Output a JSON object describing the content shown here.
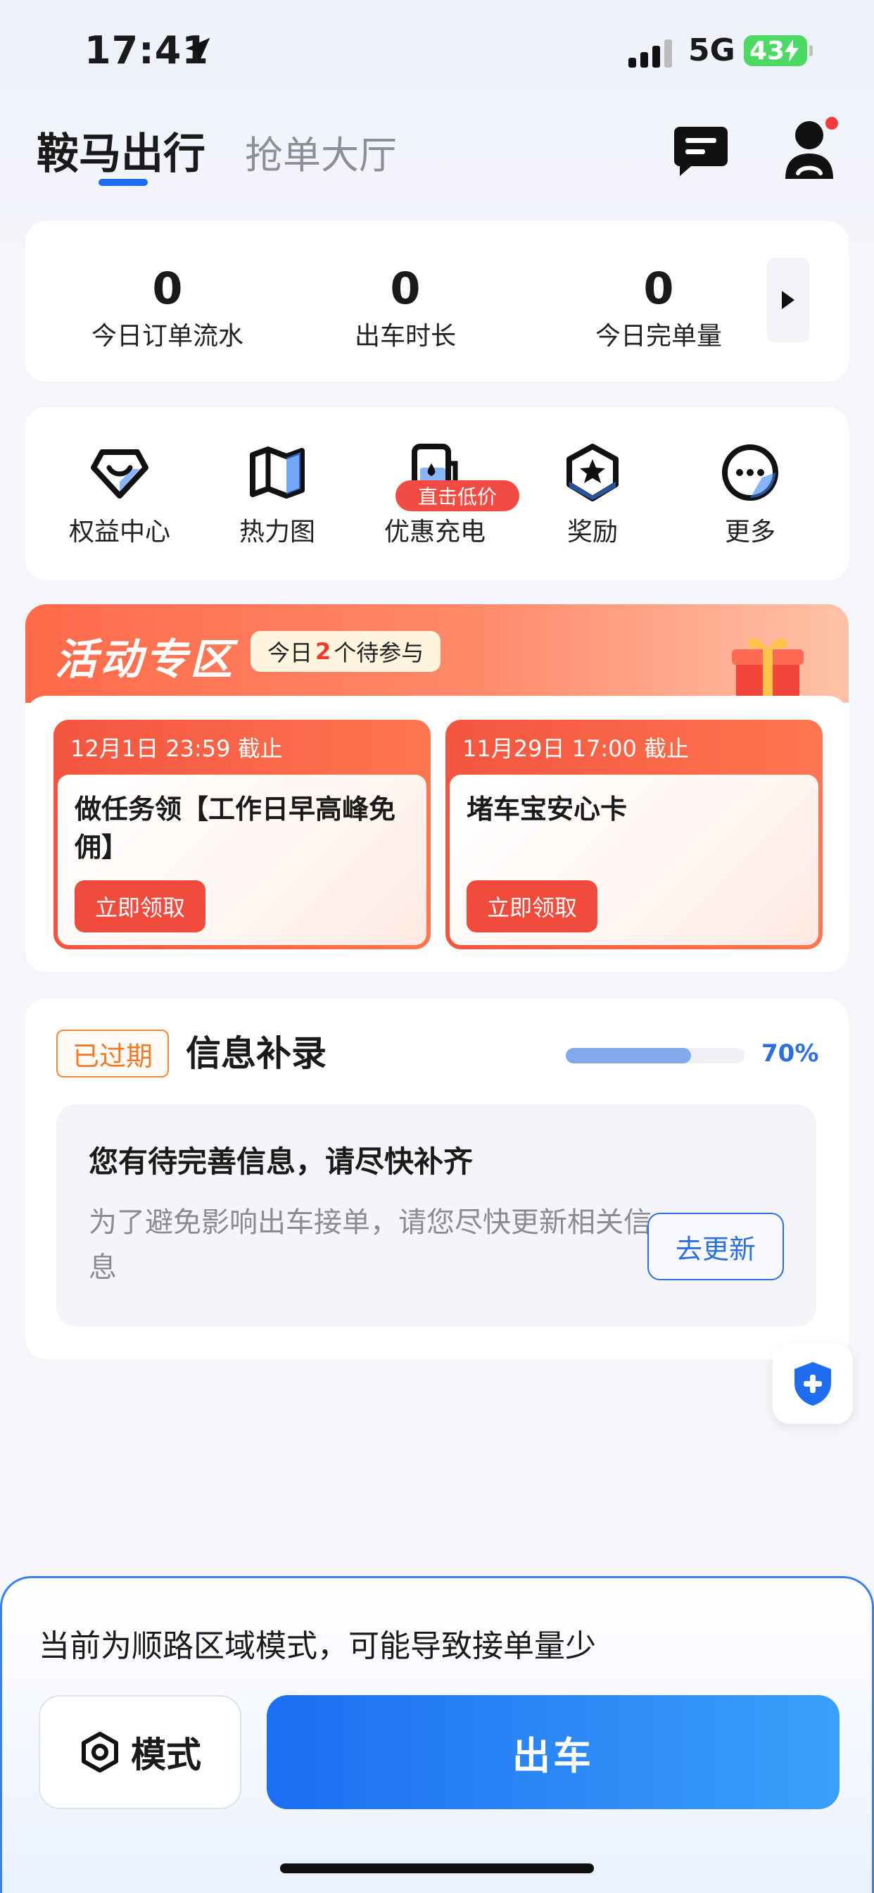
{
  "status_bar": {
    "time": "17:41",
    "network": "5G",
    "battery": "43"
  },
  "header": {
    "title": "鞍马出行",
    "tab2": "抢单大厅"
  },
  "stats": [
    {
      "value": "0",
      "label": "今日订单流水"
    },
    {
      "value": "0",
      "label": "出车时长"
    },
    {
      "value": "0",
      "label": "今日完单量"
    }
  ],
  "tools": [
    {
      "label": "权益中心",
      "icon": "benefit-icon"
    },
    {
      "label": "热力图",
      "icon": "map-icon"
    },
    {
      "label": "优惠充电",
      "icon": "charging-icon"
    },
    {
      "label": "奖励",
      "icon": "reward-icon"
    },
    {
      "label": "更多",
      "icon": "more-icon"
    }
  ],
  "tools_tag": "直击低价",
  "activity": {
    "title": "活动专区",
    "pill_prefix": "今日",
    "pill_count": "2",
    "pill_suffix": "个待参与",
    "items": [
      {
        "deadline": "12月1日 23:59 截止",
        "title": "做任务领【工作日早高峰免佣】",
        "button": "立即领取"
      },
      {
        "deadline": "11月29日 17:00 截止",
        "title": "堵车宝安心卡",
        "button": "立即领取"
      }
    ]
  },
  "info": {
    "badge": "已过期",
    "title": "信息补录",
    "progress": 0.7,
    "progress_text": "70%",
    "box_title": "您有待完善信息，请尽快补齐",
    "box_desc": "为了避免影响出车接单，请您尽快更新相关信息",
    "button": "去更新"
  },
  "bottom": {
    "tip": "当前为顺路区域模式，可能导致接单量少",
    "mode_label": "模式",
    "go_label": "出车"
  },
  "colors": {
    "primary": "#1e6cf0",
    "accent_red": "#f14b3e",
    "orange": "#f07a26"
  }
}
